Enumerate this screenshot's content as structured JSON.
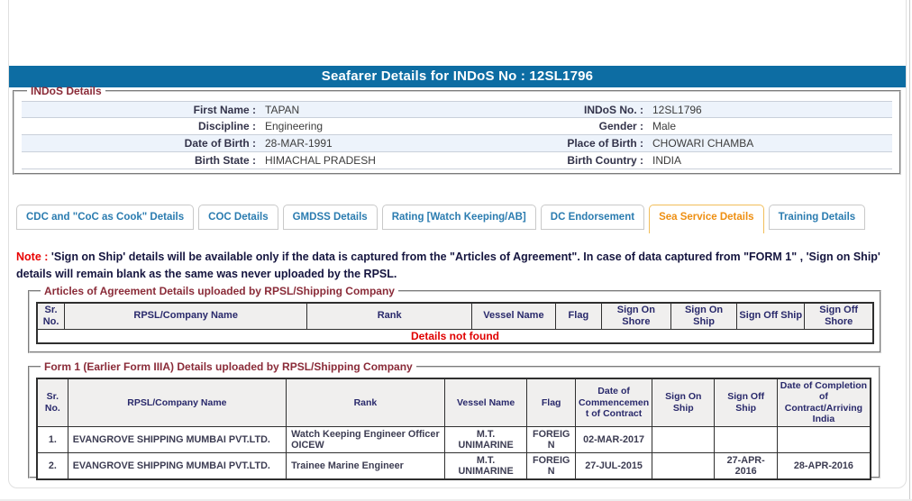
{
  "page_title": "Seafarer Details for INDoS No : 12SL1796",
  "colors": {
    "header_bar": "#0d6da3",
    "tab_text": "#2b7cb0",
    "tab_active_text": "#ee8f12",
    "tab_active_border": "#f2be5a",
    "fieldset_legend": "#8a2b38",
    "note_red": "#e80000",
    "row_stripe": "#edf3fb",
    "table_header_text": "#29296b",
    "not_found_red": "#e00000"
  },
  "indos": {
    "legend": "INDoS Details",
    "fields": [
      {
        "l1": "First Name :",
        "v1": "TAPAN",
        "l2": "INDoS No. :",
        "v2": "12SL1796"
      },
      {
        "l1": "Discipline :",
        "v1": "Engineering",
        "l2": "Gender :",
        "v2": "Male"
      },
      {
        "l1": "Date of Birth :",
        "v1": "28-MAR-1991",
        "l2": "Place of Birth :",
        "v2": "CHOWARI CHAMBA"
      },
      {
        "l1": "Birth State :",
        "v1": "HIMACHAL PRADESH",
        "l2": "Birth Country :",
        "v2": "INDIA"
      }
    ]
  },
  "tabs": [
    {
      "label": "CDC and \"CoC as Cook\" Details",
      "active": false
    },
    {
      "label": "COC Details",
      "active": false
    },
    {
      "label": "GMDSS Details",
      "active": false
    },
    {
      "label": "Rating [Watch Keeping/AB]",
      "active": false
    },
    {
      "label": "DC Endorsement",
      "active": false
    },
    {
      "label": "Sea Service Details",
      "active": true
    },
    {
      "label": "Training Details",
      "active": false
    }
  ],
  "note": {
    "prefix": "Note :",
    "body": " 'Sign on Ship' details will be available only if the data is captured from the \"Articles of Agreement\". In case of data captured from \"FORM 1\" , 'Sign on Ship' details will remain blank as the same was never uploaded by the RPSL."
  },
  "articles": {
    "legend": "Articles of Agreement Details uploaded by RPSL/Shipping Company",
    "columns": [
      "Sr. No.",
      "RPSL/Company Name",
      "Rank",
      "Vessel Name",
      "Flag",
      "Sign On Shore",
      "Sign On Ship",
      "Sign Off Ship",
      "Sign Off Shore"
    ],
    "empty_message": "Details not found"
  },
  "form1": {
    "legend": "Form 1 (Earlier Form IIIA) Details uploaded by RPSL/Shipping Company",
    "columns": [
      "Sr. No.",
      "RPSL/Company Name",
      "Rank",
      "Vessel Name",
      "Flag",
      "Date of Commencement of Contract",
      "Sign On Ship",
      "Sign Off Ship",
      "Date of Completion of Contract/Arriving India"
    ],
    "rows": [
      [
        "1.",
        "EVANGROVE SHIPPING MUMBAI PVT.LTD.",
        "Watch Keeping Engineer Officer OICEW",
        "M.T. UNIMARINE",
        "FOREIGN",
        "02-MAR-2017",
        "",
        "",
        ""
      ],
      [
        "2.",
        "EVANGROVE SHIPPING MUMBAI PVT.LTD.",
        "Trainee Marine Engineer",
        "M.T. UNIMARINE",
        "FOREIGN",
        "27-JUL-2015",
        "",
        "27-APR-2016",
        "28-APR-2016"
      ]
    ]
  }
}
